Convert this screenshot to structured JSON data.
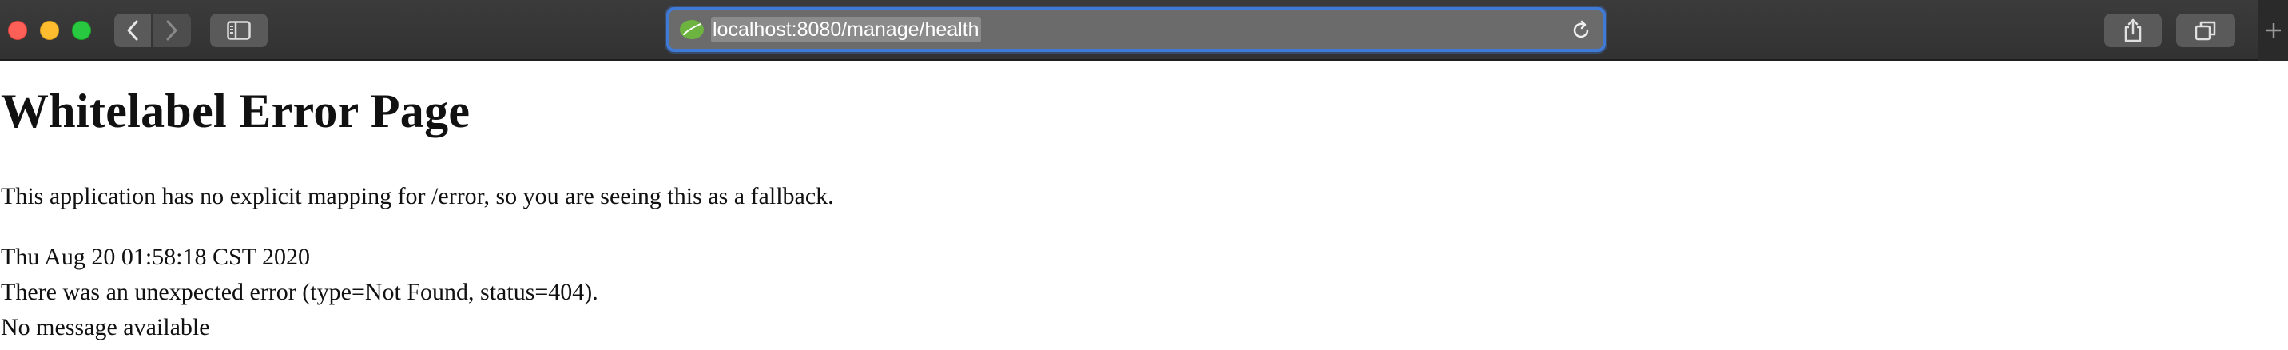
{
  "browser": {
    "url": "localhost:8080/manage/health",
    "icons": {
      "close": "close-traffic-light",
      "minimize": "minimize-traffic-light",
      "zoom": "zoom-traffic-light",
      "back": "chevron-left-icon",
      "forward": "chevron-right-icon",
      "sidebar": "sidebar-icon",
      "favicon": "spring-leaf-icon",
      "reload": "reload-icon",
      "share": "share-icon",
      "tabs": "tab-overview-icon",
      "new_tab": "plus-icon"
    },
    "colors": {
      "toolbar": "#3b3b3b",
      "address_focus": "#3f7ad6",
      "favicon_leaf": "#6db33f"
    }
  },
  "page": {
    "title": "Whitelabel Error Page",
    "description": "This application has no explicit mapping for /error, so you are seeing this as a fallback.",
    "timestamp": "Thu Aug 20 01:58:18 CST 2020",
    "error_detail": "There was an unexpected error (type=Not Found, status=404).",
    "message": "No message available"
  }
}
